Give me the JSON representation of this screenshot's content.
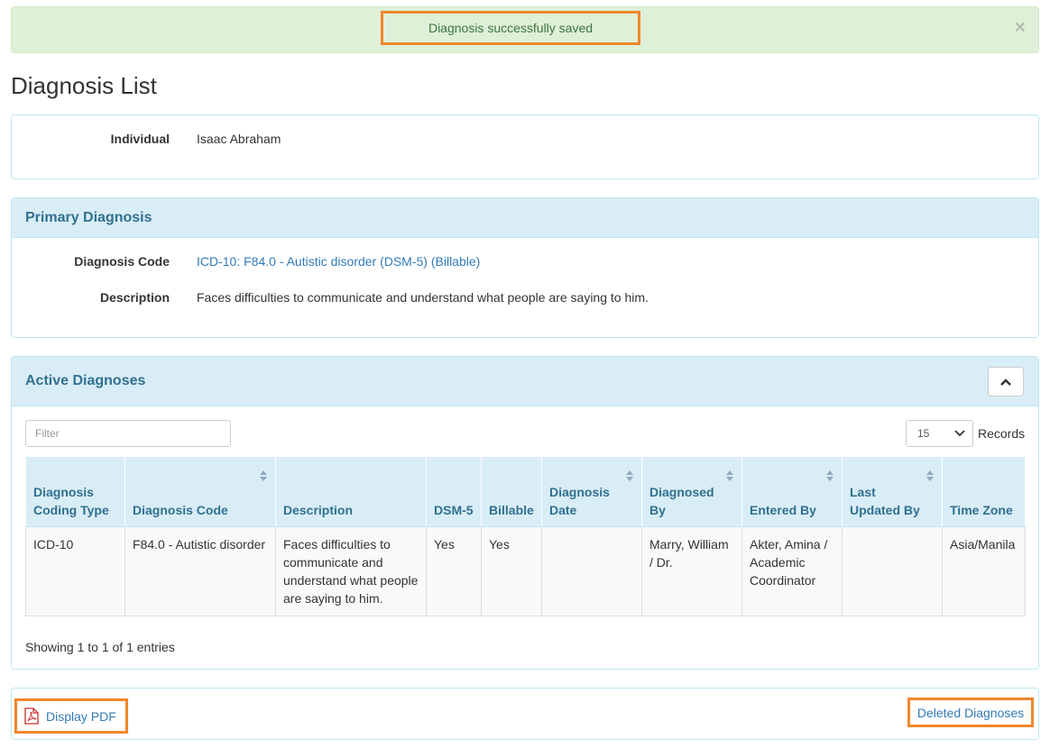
{
  "alert": {
    "message": "Diagnosis successfully saved",
    "close_glyph": "×"
  },
  "page": {
    "title": "Diagnosis List"
  },
  "individual": {
    "label": "Individual",
    "value": "Isaac Abraham"
  },
  "primary": {
    "heading": "Primary Diagnosis",
    "code_label": "Diagnosis Code",
    "code_value": "ICD-10: F84.0 - Autistic disorder (DSM-5) (Billable)",
    "desc_label": "Description",
    "desc_value": "Faces difficulties to communicate and understand what people are saying to him."
  },
  "active": {
    "heading": "Active Diagnoses",
    "filter_placeholder": "Filter",
    "records_value": "15",
    "records_label": "Records",
    "columns": [
      "Diagnosis Coding Type",
      "Diagnosis Code",
      "Description",
      "DSM-5",
      "Billable",
      "Diagnosis Date",
      "Diagnosed By",
      "Entered By",
      "Last Updated By",
      "Time Zone"
    ],
    "rows": [
      [
        "ICD-10",
        "F84.0 - Autistic disorder",
        "Faces difficulties to communicate and understand what people are saying to him.",
        "Yes",
        "Yes",
        "",
        "Marry, William / Dr.",
        "Akter, Amina / Academic Coordinator",
        "",
        "Asia/Manila"
      ]
    ],
    "showing": "Showing 1 to 1 of 1 entries"
  },
  "footer": {
    "pdf_label": "Display PDF",
    "deleted_label": "Deleted Diagnoses"
  },
  "colors": {
    "accent_highlight": "#f0862b",
    "panel_heading_bg": "#d9edf7",
    "panel_heading_text": "#31708f",
    "link": "#337ab7",
    "success_bg": "#dff0d8",
    "success_text": "#3c763d"
  },
  "icons": {
    "collapse": "chevron-up-icon",
    "select": "chevron-down-icon",
    "sort": "sort-icon",
    "pdf": "pdf-file-icon",
    "close": "close-icon"
  }
}
